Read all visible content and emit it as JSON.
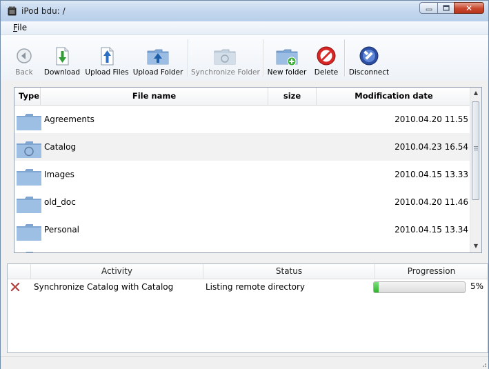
{
  "window": {
    "title": "iPod bdu: /"
  },
  "menu": {
    "file_label_first": "F",
    "file_label_rest": "ile"
  },
  "toolbar": {
    "back": "Back",
    "download": "Download",
    "upload_files": "Upload Files",
    "upload_folder": "Upload Folder",
    "synchronize_folder": "Synchronize Folder",
    "new_folder": "New folder",
    "delete": "Delete",
    "disconnect": "Disconnect"
  },
  "file_list": {
    "columns": {
      "type": "Type",
      "name": "File name",
      "size": "size",
      "date": "Modification date"
    },
    "rows": [
      {
        "name": "Agreements",
        "date": "2010.04.20 11.55",
        "icon": "folder-icon"
      },
      {
        "name": "Catalog",
        "date": "2010.04.23 16.54",
        "icon": "sync-folder-icon"
      },
      {
        "name": "Images",
        "date": "2010.04.15 13.33",
        "icon": "folder-icon"
      },
      {
        "name": "old_doc",
        "date": "2010.04.20 11.46",
        "icon": "folder-icon"
      },
      {
        "name": "Personal",
        "date": "2010.04.15 13.34",
        "icon": "folder-icon"
      }
    ]
  },
  "activity": {
    "columns": {
      "activity": "Activity",
      "status": "Status",
      "progression": "Progression"
    },
    "rows": [
      {
        "name": "Synchronize Catalog with Catalog",
        "status": "Listing remote directory",
        "progress": 0.05,
        "percent": "5%"
      }
    ]
  },
  "colors": {
    "folder": "#8fb3d9",
    "progress_fill": "#2fb12b",
    "delete": "#cc1f1f",
    "close_button": "#c8472d"
  }
}
